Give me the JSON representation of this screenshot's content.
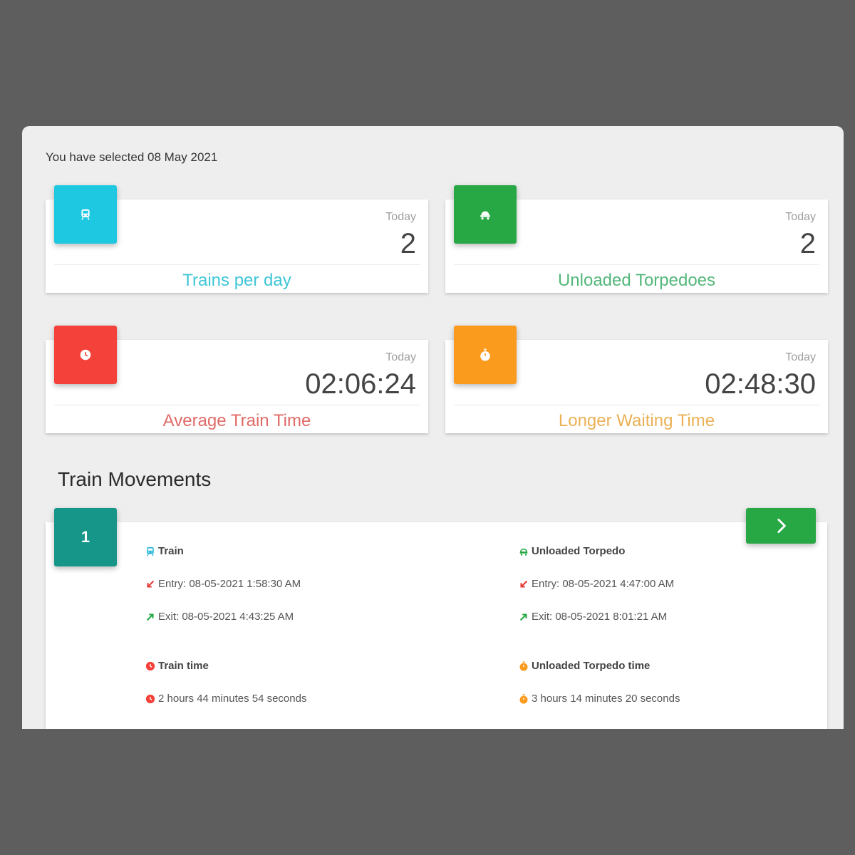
{
  "header": {
    "selected_text": "You have selected 08 May 2021"
  },
  "stats": [
    {
      "icon": "train-icon",
      "period": "Today",
      "value": "2",
      "label": "Trains per day",
      "color": "#1dc8e0",
      "label_color": "#3ec6d6"
    },
    {
      "icon": "torpedo-icon",
      "period": "Today",
      "value": "2",
      "label": "Unloaded Torpedoes",
      "color": "#27a844",
      "label_color": "#53b77a"
    },
    {
      "icon": "clock-icon",
      "period": "Today",
      "value": "02:06:24",
      "label": "Average Train Time",
      "color": "#f4413a",
      "label_color": "#e06a66"
    },
    {
      "icon": "stopwatch-icon",
      "period": "Today",
      "value": "02:48:30",
      "label": "Longer Waiting Time",
      "color": "#fb9b1e",
      "label_color": "#eab155"
    }
  ],
  "section": {
    "title": "Train Movements"
  },
  "movement": {
    "index": "1",
    "next_icon": "chevron-right-icon",
    "train": {
      "heading": "Train",
      "entry": "Entry: 08-05-2021 1:58:30 AM",
      "exit": "Exit: 08-05-2021 4:43:25 AM",
      "time_heading": "Train time",
      "time_value": "2 hours 44 minutes 54 seconds"
    },
    "torpedo": {
      "heading": "Unloaded Torpedo",
      "entry": "Entry: 08-05-2021 4:47:00 AM",
      "exit": "Exit: 08-05-2021 8:01:21 AM",
      "time_heading": "Unloaded Torpedo time",
      "time_value": "3 hours 14 minutes 20 seconds"
    }
  },
  "colors": {
    "entry_arrow": "#e53935",
    "exit_arrow": "#27a844",
    "train_icon": "#29b6d6",
    "torpedo_icon": "#27a844",
    "train_time_icon": "#f4413a",
    "torpedo_time_icon": "#fb9b1e"
  }
}
